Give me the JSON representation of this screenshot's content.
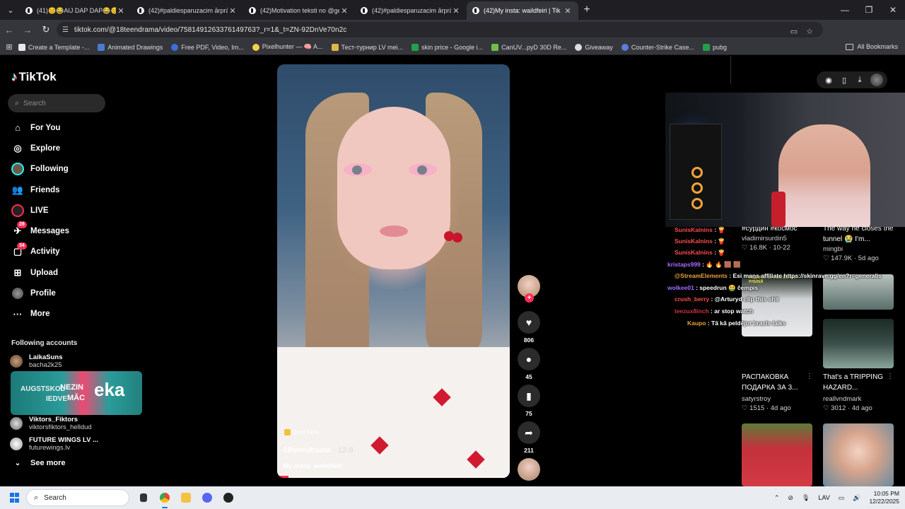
{
  "browser": {
    "tabs": [
      {
        "title": "(41)😊😂AIJ DAP DAP😂😊 (",
        "active": false
      },
      {
        "title": "(42)#paldiesparuzacim ārprāts (",
        "active": false
      },
      {
        "title": "(42)Motivation teksti no @gen",
        "active": false
      },
      {
        "title": "(42)#paldiesparuzacim ārprāts (",
        "active": false
      },
      {
        "title": "(42)My insta: waildfeiri | Tik",
        "active": true
      }
    ],
    "url": "tiktok.com/@18teendrama/video/7581491263376149763?_r=1&_t=ZN-92DnVe70n2c",
    "bookmarks": [
      {
        "label": "Create a Template -...",
        "color": "#e8e8e8"
      },
      {
        "label": "Animated Drawings",
        "color": "#4a7bd4"
      },
      {
        "label": "Free PDF, Video, Im...",
        "color": "#3b6fd8"
      },
      {
        "label": "Pixelhunter — 🧠 A...",
        "color": "#f2d14b"
      },
      {
        "label": "Тест-турнир LV mei...",
        "color": "#e0b64a"
      },
      {
        "label": "skin price - Google i...",
        "color": "#22a04b"
      },
      {
        "label": "CanUV...pyD 30D Re...",
        "color": "#6cc04a"
      },
      {
        "label": "Giveaway",
        "color": "#dddddd"
      },
      {
        "label": "Counter-Strike Case...",
        "color": "#5b7be0"
      },
      {
        "label": "pubg",
        "color": "#22a04b"
      }
    ],
    "all_bookmarks": "All Bookmarks"
  },
  "tiktok": {
    "logo": "TikTok",
    "search_placeholder": "Search",
    "nav": [
      {
        "label": "For You",
        "icon": "home-icon"
      },
      {
        "label": "Explore",
        "icon": "compass-icon"
      },
      {
        "label": "Following",
        "icon": "following-icon"
      },
      {
        "label": "Friends",
        "icon": "friends-icon"
      },
      {
        "label": "LIVE",
        "icon": "live-icon"
      },
      {
        "label": "Messages",
        "icon": "messages-icon",
        "badge": "28"
      },
      {
        "label": "Activity",
        "icon": "activity-icon",
        "badge": "34"
      },
      {
        "label": "Upload",
        "icon": "upload-icon"
      },
      {
        "label": "Profile",
        "icon": "profile-icon"
      },
      {
        "label": "More",
        "icon": "more-icon"
      }
    ],
    "following_heading": "Following accounts",
    "accounts": [
      {
        "name": "LaikaSuns",
        "handle": "bacha2k25"
      },
      {
        "name": "Viktors_Fiktors",
        "handle": "viktorsfiktors_helldud"
      },
      {
        "name": "FUTURE WINGS LV ...",
        "handle": "futurewings.lv"
      }
    ],
    "banner": {
      "t1": "AUGSTSKOL",
      "t2": "IEDVE",
      "t3": "NEZIN",
      "t4": "MĀC",
      "t5": "eka"
    },
    "see_more": "See more",
    "video": {
      "tag": "pure face",
      "author": "18teendrama",
      "date": "12-8",
      "caption": "My insta: waildfeiri",
      "progress": 0.05
    },
    "actions": {
      "likes": "806",
      "comments": "45",
      "saves": "75",
      "shares": "211"
    },
    "chat": [
      {
        "user": "SunisKalnins",
        "text": ": 🍟",
        "color": "#ff4d4d"
      },
      {
        "user": "SunisKalnins",
        "text": ": 🍟",
        "color": "#ff4d4d"
      },
      {
        "user": "SunisKalnins",
        "text": ": 🍟",
        "color": "#ff4d4d"
      },
      {
        "user": "kristaps999",
        "text": ": 🔥 🔥 🟫 🟫",
        "color": "#a66cff"
      },
      {
        "user": "@StreamElements",
        "text": ": Esi mans affiliate https://skinrave.gg/en?r=generalis",
        "color": "#e8a23c"
      },
      {
        "user": "wolkee01",
        "text": ": speedrun 🤮 čempis",
        "color": "#a66cff"
      },
      {
        "user": "crush_berry",
        "text": ": @Arturyd clip this shit",
        "color": "#ff4d4d"
      },
      {
        "user": "teezux8inch",
        "text": ": ar stop watch",
        "color": "#cc3344"
      },
      {
        "user": "Kaupo",
        "text": ": Tā kā peldējot brasls laiks",
        "color": "#e8a23c"
      }
    ],
    "grid": [
      {
        "title": "#сурдин #космос",
        "user": "vladimirsurdin5",
        "meta": "♡ 16.8K · 10-22"
      },
      {
        "title": "The way he closes the tunnel 😭 I'm...",
        "user": "mingbi",
        "meta": "♡ 147.9K · 5d ago"
      },
      {
        "title": "РАСПАКОВКА ПОДАРКА ЗА 3...",
        "user": "satyrstroy",
        "meta": "♡ 1515 · 4d ago"
      },
      {
        "title": "That's a TRIPPING HAZARD...",
        "user": "reallvndmark",
        "meta": "♡ 3012 · 4d ago"
      }
    ],
    "grid_overlay_text": "ПОДАРОК ЗА 3 500 000 000 РУБЛЕЙ"
  },
  "taskbar": {
    "search": "Search",
    "lang": "LAV",
    "time": "10:05 PM",
    "date": "12/22/2025"
  }
}
